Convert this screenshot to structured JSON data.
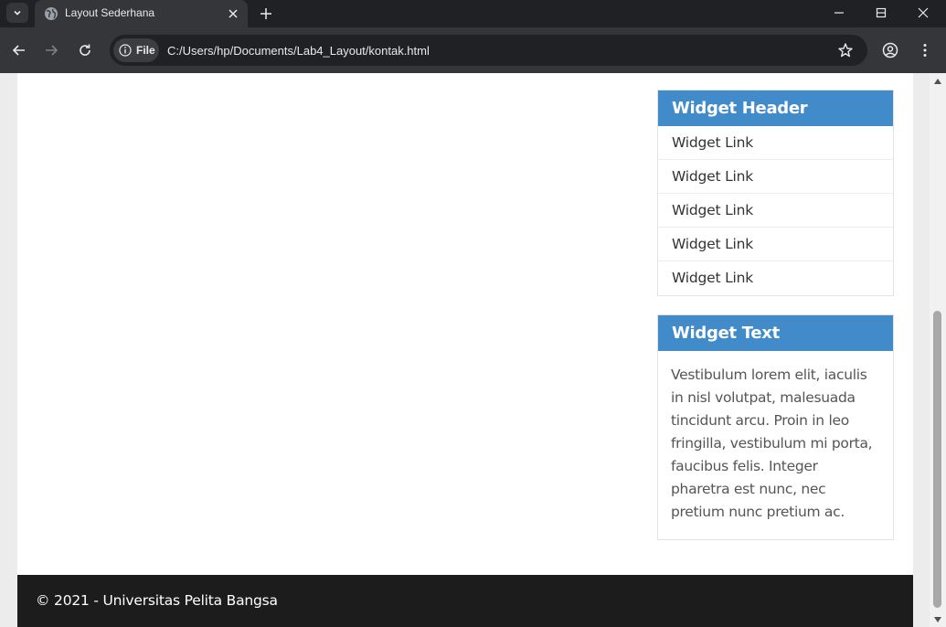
{
  "browser": {
    "tab": {
      "title": "Layout Sederhana"
    },
    "address": {
      "security_chip": "File",
      "url": "C:/Users/hp/Documents/Lab4_Layout/kontak.html"
    }
  },
  "sidebar": {
    "links_widget": {
      "header": "Widget Header",
      "links": [
        "Widget Link",
        "Widget Link",
        "Widget Link",
        "Widget Link",
        "Widget Link"
      ]
    },
    "text_widget": {
      "header": "Widget Text",
      "body": "Vestibulum lorem elit, iaculis in nisl volutpat, malesuada tincidunt arcu. Proin in leo fringilla, vestibulum mi porta, faucibus felis. Integer pharetra est nunc, nec pretium nunc pretium ac."
    }
  },
  "footer": {
    "text": "© 2021 - Universitas Pelita Bangsa"
  },
  "colors": {
    "widget_header_bg": "#428bca",
    "footer_bg": "#1c1c1c",
    "browser_chrome": "#35363a"
  }
}
